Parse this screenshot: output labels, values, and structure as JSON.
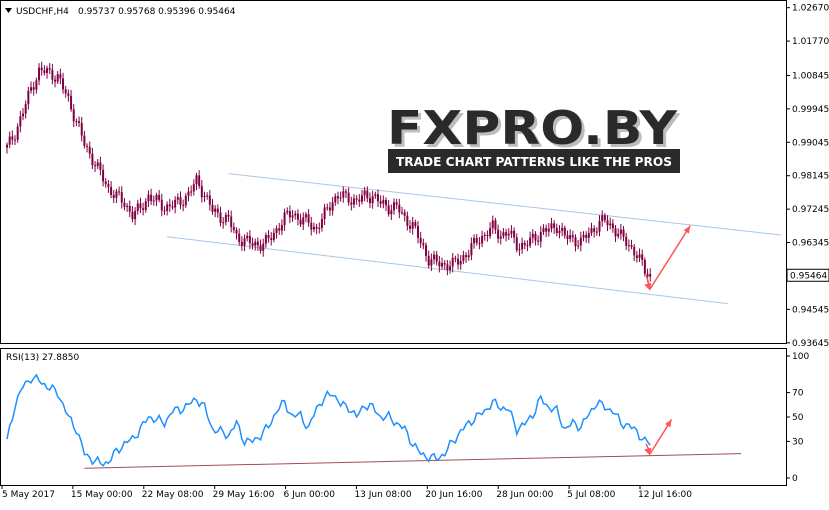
{
  "chart_data": [
    {
      "type": "candlestick",
      "symbol_label": "USDCHF,H4",
      "ohlc_label": "0.95737 0.95768 0.95396 0.95464",
      "last_price": 0.95464,
      "last_price_label": "0.95464",
      "ylim": [
        0.9364,
        1.0285
      ],
      "price_ticks": [
        "1.02670",
        "1.01770",
        "1.00845",
        "0.99945",
        "0.99045",
        "0.98145",
        "0.97245",
        "0.96345",
        "0.95445",
        "0.94545",
        "0.93645"
      ],
      "x_ticks": [
        "5 May 2017",
        "15 May 00:00",
        "22 May 08:00",
        "29 May 16:00",
        "6 Jun 00:00",
        "13 Jun 08:00",
        "20 Jun 16:00",
        "28 Jun 00:00",
        "5 Jul 08:00",
        "12 Jul 16:00"
      ],
      "close_path": [
        [
          0,
          0.989
        ],
        [
          3,
          0.993
        ],
        [
          6,
          0.9985
        ],
        [
          9,
          1.005
        ],
        [
          12,
          1.0095
        ],
        [
          15,
          1.0095
        ],
        [
          19,
          1.008
        ],
        [
          23,
          1.002
        ],
        [
          26,
          0.996
        ],
        [
          29,
          0.99
        ],
        [
          32,
          0.986
        ],
        [
          35,
          0.982
        ],
        [
          38,
          0.978
        ],
        [
          41,
          0.976
        ],
        [
          44,
          0.974
        ],
        [
          47,
          0.971
        ],
        [
          50,
          0.9725
        ],
        [
          53,
          0.976
        ],
        [
          56,
          0.9745
        ],
        [
          59,
          0.973
        ],
        [
          62,
          0.9735
        ],
        [
          65,
          0.9745
        ],
        [
          68,
          0.9765
        ],
        [
          71,
          0.98
        ],
        [
          74,
          0.9765
        ],
        [
          77,
          0.972
        ],
        [
          80,
          0.9705
        ],
        [
          83,
          0.9695
        ],
        [
          86,
          0.965
        ],
        [
          89,
          0.964
        ],
        [
          92,
          0.963
        ],
        [
          95,
          0.963
        ],
        [
          98,
          0.964
        ],
        [
          101,
          0.967
        ],
        [
          104,
          0.97
        ],
        [
          107,
          0.9715
        ],
        [
          110,
          0.9695
        ],
        [
          113,
          0.969
        ],
        [
          116,
          0.967
        ],
        [
          119,
          0.971
        ],
        [
          122,
          0.975
        ],
        [
          125,
          0.976
        ],
        [
          128,
          0.9755
        ],
        [
          131,
          0.9745
        ],
        [
          134,
          0.976
        ],
        [
          137,
          0.976
        ],
        [
          140,
          0.974
        ],
        [
          143,
          0.973
        ],
        [
          146,
          0.973
        ],
        [
          149,
          0.97
        ],
        [
          152,
          0.968
        ],
        [
          155,
          0.9635
        ],
        [
          158,
          0.959
        ],
        [
          161,
          0.958
        ],
        [
          164,
          0.9575
        ],
        [
          167,
          0.9575
        ],
        [
          170,
          0.959
        ],
        [
          173,
          0.961
        ],
        [
          176,
          0.964
        ],
        [
          179,
          0.9655
        ],
        [
          182,
          0.9675
        ],
        [
          185,
          0.9655
        ],
        [
          188,
          0.966
        ],
        [
          191,
          0.963
        ],
        [
          194,
          0.9625
        ],
        [
          197,
          0.9645
        ],
        [
          200,
          0.966
        ],
        [
          203,
          0.967
        ],
        [
          206,
          0.968
        ],
        [
          209,
          0.965
        ],
        [
          212,
          0.9645
        ],
        [
          215,
          0.9635
        ],
        [
          218,
          0.966
        ],
        [
          221,
          0.968
        ],
        [
          224,
          0.9695
        ],
        [
          227,
          0.9675
        ],
        [
          230,
          0.965
        ],
        [
          233,
          0.963
        ],
        [
          236,
          0.96
        ],
        [
          239,
          0.956
        ],
        [
          241,
          0.9546
        ]
      ],
      "channel_upper": [
        [
          83,
          0.982
        ],
        [
          290,
          0.9655
        ]
      ],
      "channel_lower": [
        [
          60,
          0.965
        ],
        [
          270,
          0.947
        ]
      ],
      "forecast_arrow": [
        [
          241,
          0.951
        ],
        [
          256,
          0.968
        ]
      ]
    },
    {
      "type": "line",
      "indicator_label": "RSI(13) 27.8850",
      "ylim": [
        0,
        100
      ],
      "y_ticks": [
        "100",
        "70",
        "50",
        "30",
        "0"
      ],
      "series": [
        {
          "color": "#1e90ff",
          "values": [
            [
              0,
              30
            ],
            [
              3,
              60
            ],
            [
              6,
              75
            ],
            [
              9,
              82
            ],
            [
              12,
              80
            ],
            [
              15,
              75
            ],
            [
              19,
              70
            ],
            [
              23,
              50
            ],
            [
              26,
              40
            ],
            [
              29,
              20
            ],
            [
              32,
              15
            ],
            [
              35,
              12
            ],
            [
              38,
              13
            ],
            [
              41,
              22
            ],
            [
              44,
              28
            ],
            [
              47,
              32
            ],
            [
              50,
              40
            ],
            [
              53,
              50
            ],
            [
              56,
              48
            ],
            [
              59,
              45
            ],
            [
              62,
              55
            ],
            [
              65,
              56
            ],
            [
              68,
              60
            ],
            [
              71,
              65
            ],
            [
              74,
              58
            ],
            [
              77,
              40
            ],
            [
              80,
              38
            ],
            [
              83,
              35
            ],
            [
              86,
              45
            ],
            [
              89,
              30
            ],
            [
              92,
              30
            ],
            [
              95,
              35
            ],
            [
              98,
              42
            ],
            [
              101,
              55
            ],
            [
              104,
              62
            ],
            [
              107,
              50
            ],
            [
              110,
              52
            ],
            [
              113,
              40
            ],
            [
              116,
              58
            ],
            [
              119,
              65
            ],
            [
              122,
              70
            ],
            [
              125,
              60
            ],
            [
              128,
              58
            ],
            [
              131,
              50
            ],
            [
              134,
              60
            ],
            [
              137,
              58
            ],
            [
              140,
              50
            ],
            [
              143,
              50
            ],
            [
              146,
              45
            ],
            [
              149,
              40
            ],
            [
              152,
              28
            ],
            [
              155,
              20
            ],
            [
              158,
              17
            ],
            [
              161,
              16
            ],
            [
              164,
              20
            ],
            [
              167,
              30
            ],
            [
              170,
              38
            ],
            [
              173,
              45
            ],
            [
              176,
              50
            ],
            [
              179,
              55
            ],
            [
              182,
              62
            ],
            [
              185,
              58
            ],
            [
              188,
              56
            ],
            [
              191,
              40
            ],
            [
              194,
              44
            ],
            [
              197,
              52
            ],
            [
              200,
              65
            ],
            [
              203,
              58
            ],
            [
              206,
              55
            ],
            [
              209,
              40
            ],
            [
              212,
              45
            ],
            [
              215,
              42
            ],
            [
              218,
              52
            ],
            [
              221,
              62
            ],
            [
              224,
              58
            ],
            [
              227,
              55
            ],
            [
              230,
              45
            ],
            [
              233,
              43
            ],
            [
              236,
              38
            ],
            [
              239,
              30
            ],
            [
              241,
              28
            ]
          ]
        }
      ],
      "trendline": [
        [
          29,
          8
        ],
        [
          275,
          20
        ]
      ],
      "forecast_arrow": [
        [
          241,
          20
        ],
        [
          249,
          48
        ]
      ]
    }
  ],
  "watermark": {
    "brand": "FXPRO.BY",
    "tagline": "TRADE CHART PATTERNS LIKE THE PROS"
  },
  "colors": {
    "candle": "#800040",
    "channel": "#a9c6e3",
    "rsi_line": "#1e90ff",
    "rsi_trend": "#a05050",
    "arrow": "#ff5555",
    "axis": "#000000"
  }
}
